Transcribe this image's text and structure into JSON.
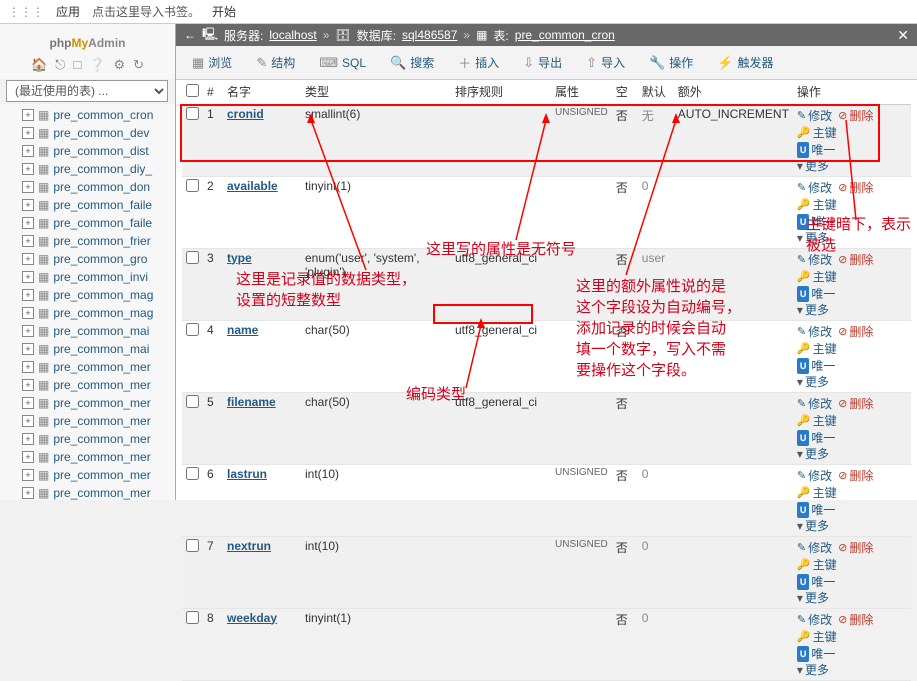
{
  "bookmark": {
    "apps": "应用",
    "hint": "点击这里导入书签。",
    "start": "开始"
  },
  "logo": {
    "php": "php",
    "my": "My",
    "admin": "Admin"
  },
  "recent_tables_label": "(最近使用的表) ...",
  "sidebar_items": [
    "pre_common_cron",
    "pre_common_dev",
    "pre_common_dist",
    "pre_common_diy_",
    "pre_common_don",
    "pre_common_faile",
    "pre_common_faile",
    "pre_common_frier",
    "pre_common_gro",
    "pre_common_invi",
    "pre_common_mag",
    "pre_common_mag",
    "pre_common_mai",
    "pre_common_mai",
    "pre_common_mer",
    "pre_common_mer",
    "pre_common_mer",
    "pre_common_mer",
    "pre_common_mer",
    "pre_common_mer",
    "pre_common_mer",
    "pre_common_mer"
  ],
  "breadcrumb": {
    "server_lbl": "服务器:",
    "server": "localhost",
    "db_lbl": "数据库:",
    "db": "sql486587",
    "table_lbl": "表:",
    "table": "pre_common_cron"
  },
  "tabs": [
    {
      "icon": "▦",
      "label": "浏览"
    },
    {
      "icon": "✎",
      "label": "结构"
    },
    {
      "icon": "⌨",
      "label": "SQL"
    },
    {
      "icon": "🔍",
      "label": "搜索"
    },
    {
      "icon": "＋",
      "label": "插入"
    },
    {
      "icon": "⇩",
      "label": "导出"
    },
    {
      "icon": "⇧",
      "label": "导入"
    },
    {
      "icon": "🔧",
      "label": "操作"
    },
    {
      "icon": "⚡",
      "label": "触发器"
    }
  ],
  "columns": {
    "num": "#",
    "name": "名字",
    "type": "类型",
    "collation": "排序规则",
    "attr": "属性",
    "null": "空",
    "default": "默认",
    "extra": "额外",
    "ops": "操作"
  },
  "rows": [
    {
      "n": 1,
      "name": "cronid",
      "type": "smallint(6)",
      "coll": "",
      "attr": "UNSIGNED",
      "null": "否",
      "def": "无",
      "extra": "AUTO_INCREMENT"
    },
    {
      "n": 2,
      "name": "available",
      "type": "tinyint(1)",
      "coll": "",
      "attr": "",
      "null": "否",
      "def": "0",
      "extra": ""
    },
    {
      "n": 3,
      "name": "type",
      "type": "enum('user', 'system', 'plugin')",
      "coll": "utf8_general_ci",
      "attr": "",
      "null": "否",
      "def": "user",
      "extra": ""
    },
    {
      "n": 4,
      "name": "name",
      "type": "char(50)",
      "coll": "utf8_general_ci",
      "attr": "",
      "null": "否",
      "def": "",
      "extra": ""
    },
    {
      "n": 5,
      "name": "filename",
      "type": "char(50)",
      "coll": "utf8_general_ci",
      "attr": "",
      "null": "否",
      "def": "",
      "extra": ""
    },
    {
      "n": 6,
      "name": "lastrun",
      "type": "int(10)",
      "coll": "",
      "attr": "UNSIGNED",
      "null": "否",
      "def": "0",
      "extra": ""
    },
    {
      "n": 7,
      "name": "nextrun",
      "type": "int(10)",
      "coll": "",
      "attr": "UNSIGNED",
      "null": "否",
      "def": "0",
      "extra": ""
    },
    {
      "n": 8,
      "name": "weekday",
      "type": "tinyint(1)",
      "coll": "",
      "attr": "",
      "null": "否",
      "def": "0",
      "extra": ""
    }
  ],
  "ops": {
    "edit": "修改",
    "drop": "删除",
    "primary": "主键",
    "unique": "唯一",
    "more": "更多"
  },
  "annotations": {
    "type_note": "这里是记录值的数据类型，\n设置的短整数型",
    "attr_note": "这里写的属性是无符号",
    "extra_note": "这里的额外属性说的是\n这个字段设为自动编号，\n添加记录的时候会自动\n填一个数字，写入不需\n要操作这个字段。",
    "encoding_note": "编码类型",
    "pk_note": "主键暗下，表示被选"
  }
}
